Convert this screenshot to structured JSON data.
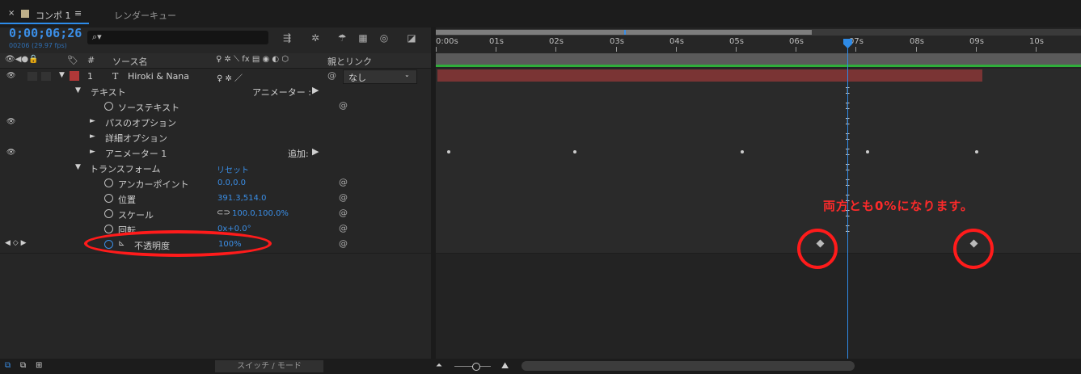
{
  "tabs": {
    "close": "×",
    "comp_label": "コンポ 1",
    "menu": "≡",
    "render_queue": "レンダーキュー"
  },
  "timecode": {
    "value": "0;00;06;26",
    "frames_fps": "00206 (29.97 fps)"
  },
  "search": {
    "icon": "⌕▾"
  },
  "header": {
    "num": "#",
    "source_name": "ソース名",
    "switches": "♀ ✲ ⟍ fx ▤ ◉ ◐ ⬡",
    "parent": "親とリンク"
  },
  "layers": {
    "layer1": {
      "num": "1",
      "type": "T",
      "name": "Hiroki & Nana",
      "parent_value": "なし",
      "color": "#b03838"
    },
    "text_group": {
      "label": "テキスト",
      "animator": "アニメーター :",
      "source_text": "ソーステキスト",
      "path_options": "パスのオプション",
      "more_options": "詳細オプション",
      "animator1": "アニメーター 1",
      "add": "追加:"
    },
    "transform": {
      "label": "トランスフォーム",
      "reset": "リセット",
      "anchor_label": "アンカーポイント",
      "anchor_value": "0.0,0.0",
      "position_label": "位置",
      "position_value": "391.3,514.0",
      "scale_label": "スケール",
      "scale_value": "100.0,100.0%",
      "rotation_label": "回転",
      "rotation_value": "0x+0.0°",
      "opacity_label": "不透明度",
      "opacity_value": "100%"
    }
  },
  "ruler": {
    "ticks": [
      "0:00s",
      "01s",
      "02s",
      "03s",
      "04s",
      "05s",
      "06s",
      "07s",
      "08s",
      "09s",
      "10s"
    ]
  },
  "annotation": {
    "text": "両方とも0%になります。",
    "color": "#ff2a2a"
  },
  "footer": {
    "switch_modes": "スイッチ / モード"
  },
  "colors": {
    "accent": "#2e8ae6",
    "layer_bar": "#7a3434",
    "work_area_line": "#2fae3a"
  }
}
